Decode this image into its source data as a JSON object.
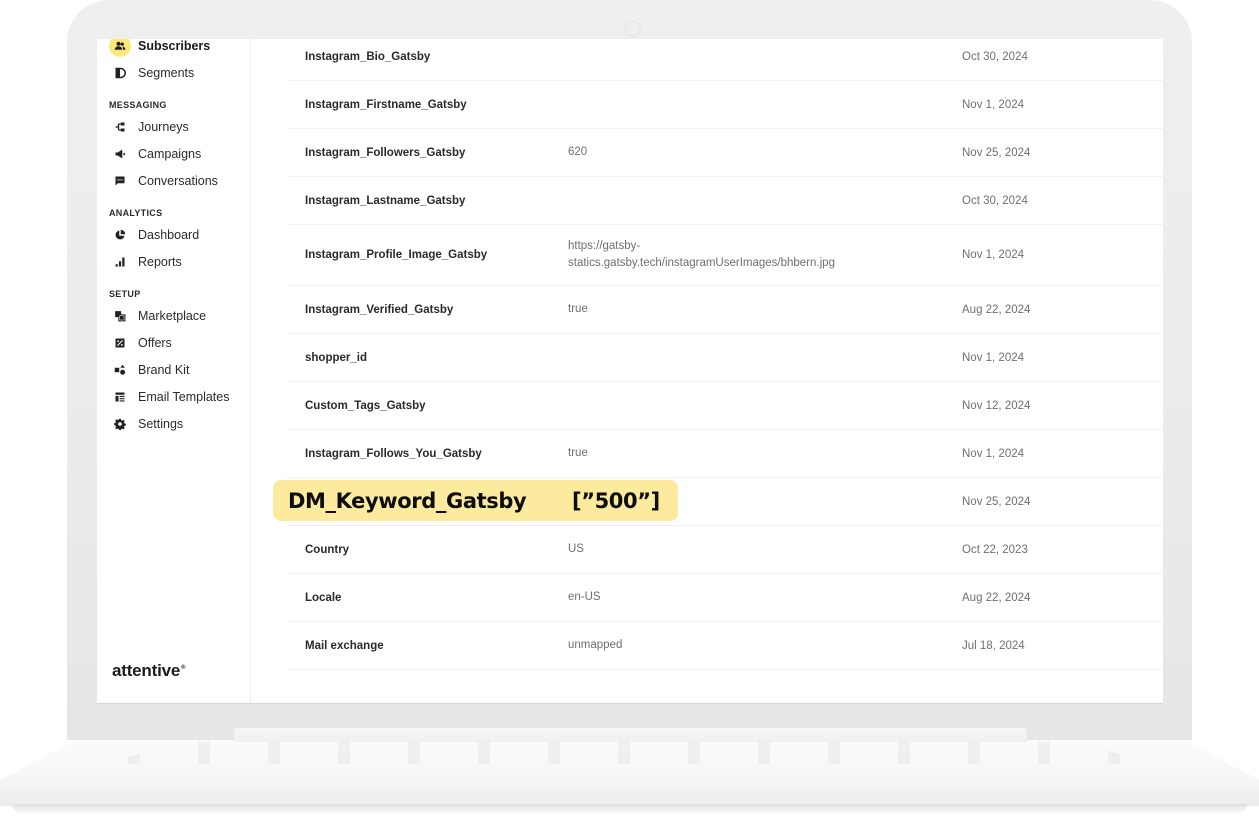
{
  "sidebar": {
    "items_top": [
      {
        "label": "Subscribers",
        "icon": "users-icon",
        "active": true
      },
      {
        "label": "Segments",
        "icon": "segments-icon",
        "active": false
      }
    ],
    "sections": [
      {
        "title": "MESSAGING",
        "items": [
          {
            "label": "Journeys",
            "icon": "journeys-icon"
          },
          {
            "label": "Campaigns",
            "icon": "megaphone-icon"
          },
          {
            "label": "Conversations",
            "icon": "chat-icon"
          }
        ]
      },
      {
        "title": "ANALYTICS",
        "items": [
          {
            "label": "Dashboard",
            "icon": "pie-chart-icon"
          },
          {
            "label": "Reports",
            "icon": "bar-chart-icon"
          }
        ]
      },
      {
        "title": "SETUP",
        "items": [
          {
            "label": "Marketplace",
            "icon": "marketplace-icon"
          },
          {
            "label": "Offers",
            "icon": "offer-percent-icon"
          },
          {
            "label": "Brand Kit",
            "icon": "brand-kit-icon"
          },
          {
            "label": "Email Templates",
            "icon": "email-template-icon"
          },
          {
            "label": "Settings",
            "icon": "gear-icon"
          }
        ]
      }
    ],
    "logo": "attentive",
    "logo_mark": "®"
  },
  "properties_table": {
    "rows": [
      {
        "name": "Instagram_Bio_Gatsby",
        "value": "",
        "date": "Oct 30, 2024"
      },
      {
        "name": "Instagram_Firstname_Gatsby",
        "value": "",
        "date": "Nov 1, 2024"
      },
      {
        "name": "Instagram_Followers_Gatsby",
        "value": "620",
        "date": "Nov 25, 2024"
      },
      {
        "name": "Instagram_Lastname_Gatsby",
        "value": "",
        "date": "Oct 30, 2024"
      },
      {
        "name": "Instagram_Profile_Image_Gatsby",
        "value": "https://gatsby-statics.gatsby.tech/instagramUserImages/bhbern.jpg",
        "value_line1": "https://gatsby-",
        "value_line2": "statics.gatsby.tech/instagramUserImages/bhbern.jpg",
        "date": "Nov 1, 2024"
      },
      {
        "name": "Instagram_Verified_Gatsby",
        "value": "true",
        "date": "Aug 22, 2024"
      },
      {
        "name": "shopper_id",
        "value": "",
        "date": "Nov 1, 2024"
      },
      {
        "name": "Custom_Tags_Gatsby",
        "value": "",
        "date": "Nov 12, 2024"
      },
      {
        "name": "Instagram_Follows_You_Gatsby",
        "value": "true",
        "date": "Nov 1, 2024"
      },
      {
        "name": "DM_Keyword_Gatsby",
        "value": "[”500”]",
        "date": "Nov 25, 2024",
        "highlighted": true
      },
      {
        "name": "Country",
        "value": "US",
        "date": "Oct 22, 2023"
      },
      {
        "name": "Locale",
        "value": "en-US",
        "date": "Aug 22, 2024"
      },
      {
        "name": "Mail exchange",
        "value": "unmapped",
        "date": "Jul 18, 2024"
      }
    ]
  },
  "colors": {
    "active_nav_bg": "#fde97a",
    "highlight_bg": "#fcea9e"
  }
}
